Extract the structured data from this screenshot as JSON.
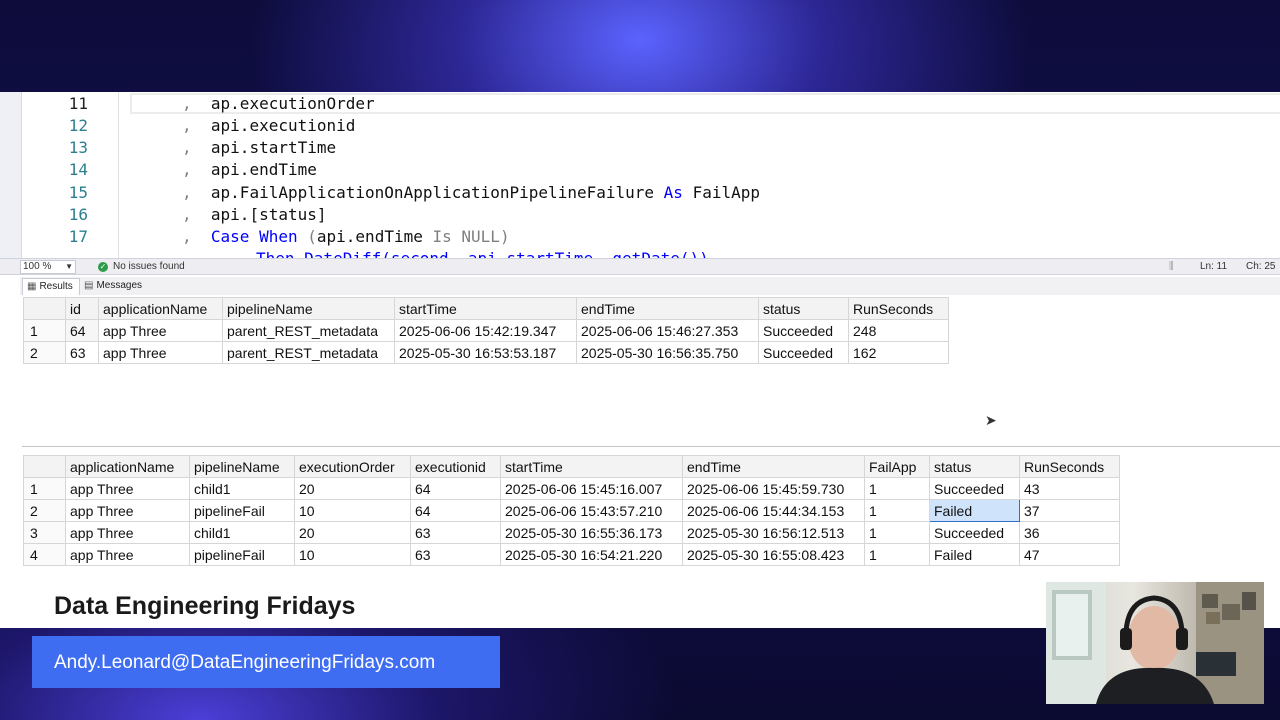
{
  "editor": {
    "lines": [
      {
        "no": "11",
        "comma": ",",
        "text": "ap.executionOrder"
      },
      {
        "no": "12",
        "comma": ",",
        "text": "api.executionid"
      },
      {
        "no": "13",
        "comma": ",",
        "text": "api.startTime"
      },
      {
        "no": "14",
        "comma": ",",
        "text": "api.endTime"
      },
      {
        "no": "15",
        "comma": ",",
        "text": "ap.FailApplicationOnApplicationPipelineFailure",
        "as_kw": "As",
        "alias": "FailApp"
      },
      {
        "no": "16",
        "comma": ",",
        "text": "api.[status]"
      },
      {
        "no": "17",
        "comma": ",",
        "case_kw": "Case",
        "when_kw": "When",
        "open": "(",
        "expr": "api.endTime",
        "is_kw": "Is",
        "null_kw": "NULL",
        "close": ")"
      },
      {
        "partial": "Then DateDiff(second, api.startTime, getDate())"
      }
    ]
  },
  "status_bar": {
    "zoom": "100 %",
    "issues": "No issues found",
    "ln": "Ln: 11",
    "ch": "Ch: 25"
  },
  "tabs": {
    "results": "Results",
    "messages": "Messages"
  },
  "grid1": {
    "columns": [
      "id",
      "applicationName",
      "pipelineName",
      "startTime",
      "endTime",
      "status",
      "RunSeconds"
    ],
    "rows": [
      [
        "1",
        "64",
        "app Three",
        "parent_REST_metadata",
        "2025-06-06 15:42:19.347",
        "2025-06-06 15:46:27.353",
        "Succeeded",
        "248"
      ],
      [
        "2",
        "63",
        "app Three",
        "parent_REST_metadata",
        "2025-05-30 16:53:53.187",
        "2025-05-30 16:56:35.750",
        "Succeeded",
        "162"
      ]
    ]
  },
  "grid2": {
    "columns": [
      "applicationName",
      "pipelineName",
      "executionOrder",
      "executionid",
      "startTime",
      "endTime",
      "FailApp",
      "status",
      "RunSeconds"
    ],
    "rows": [
      [
        "1",
        "app Three",
        "child1",
        "20",
        "64",
        "2025-06-06 15:45:16.007",
        "2025-06-06 15:45:59.730",
        "1",
        "Succeeded",
        "43"
      ],
      [
        "2",
        "app Three",
        "pipelineFail",
        "10",
        "64",
        "2025-06-06 15:43:57.210",
        "2025-06-06 15:44:34.153",
        "1",
        "Failed",
        "37"
      ],
      [
        "3",
        "app Three",
        "child1",
        "20",
        "63",
        "2025-05-30 16:55:36.173",
        "2025-05-30 16:56:12.513",
        "1",
        "Succeeded",
        "36"
      ],
      [
        "4",
        "app Three",
        "pipelineFail",
        "10",
        "63",
        "2025-05-30 16:54:21.220",
        "2025-05-30 16:55:08.423",
        "1",
        "Failed",
        "47"
      ]
    ]
  },
  "overlay": {
    "show_title": "Data Engineering Fridays",
    "email": "Andy.Leonard@DataEngineeringFridays.com"
  },
  "colors": {
    "keyword": "#0000ff",
    "function": "#ff00ff",
    "line_number": "#2b7f8f",
    "email_bar": "#3f6df2",
    "selected_cell": "#cfe3fb"
  }
}
